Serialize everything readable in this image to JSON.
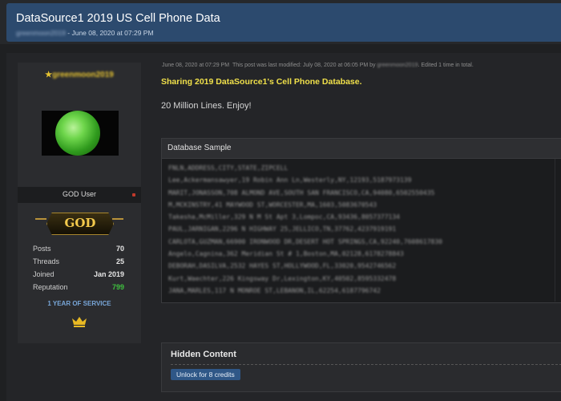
{
  "thread": {
    "title": "DataSource1 2019 US Cell Phone Data",
    "author": "greenmoon2019",
    "date_text": " - June 08, 2020 at 07:29 PM"
  },
  "user": {
    "name": "greenmoon2019",
    "title": "GOD User",
    "badge": "GOD",
    "stats": [
      {
        "label": "Posts",
        "value": "70"
      },
      {
        "label": "Threads",
        "value": "25"
      },
      {
        "label": "Joined",
        "value": "Jan 2019"
      },
      {
        "label": "Reputation",
        "value": "799"
      }
    ],
    "service": "1 YEAR OF SERVICE"
  },
  "post": {
    "meta_date": "June 08, 2020 at 07:29 PM",
    "meta_modified": "This post was last modified: July 08, 2020 at 06:05 PM by",
    "meta_editor": "greenmoon2019",
    "meta_edits": "Edited 1 time in total.",
    "headline": "Sharing 2019 DataSource1's Cell Phone Database.",
    "text": "20 Million Lines. Enjoy!"
  },
  "code": {
    "title": "Database Sample",
    "lines": [
      "FNLN,ADDRESS,CITY,STATE,ZIPCELL",
      "Lee,Ackermansawyer,19 Robin Ann Ln,Westerly,NY,12193,5187973139",
      "MARIT,JONASSON,708 ALMOND AVE,SOUTH SAN FRANCISCO,CA,94080,6502550435",
      "M,MCKINSTRY,41 MAYWOOD ST,WORCESTER,MA,1603,5083670543",
      "Takesha,McMiller,329 N M St Apt 3,Lompoc,CA,93436,8057377134",
      "PAUL,JARNIGAN,2296 N HIGHWAY 25,JELLICO,TN,37762,4237919191",
      "CARLOTA,GUZMAN,66900 IRONWOOD DR,DESERT HOT SPRINGS,CA,92240,7608617830",
      "Angelo,Cagnina,362 Meridian St # 1,Boston,MA,02128,6178278843",
      "DEBORAH,DASILVA,2532 HAYES ST,HOLLYWOOD,FL,33020,9542746562",
      "Kurt,Waechter,226 Kingsway Dr,Lexington,KY,40502,8595332478",
      "JANA,MARLES,117 N MONROE ST,LEBANON,IL,62254,6187796742"
    ]
  },
  "hidden": {
    "title": "Hidden Content",
    "button": "Unlock for 8 credits"
  }
}
